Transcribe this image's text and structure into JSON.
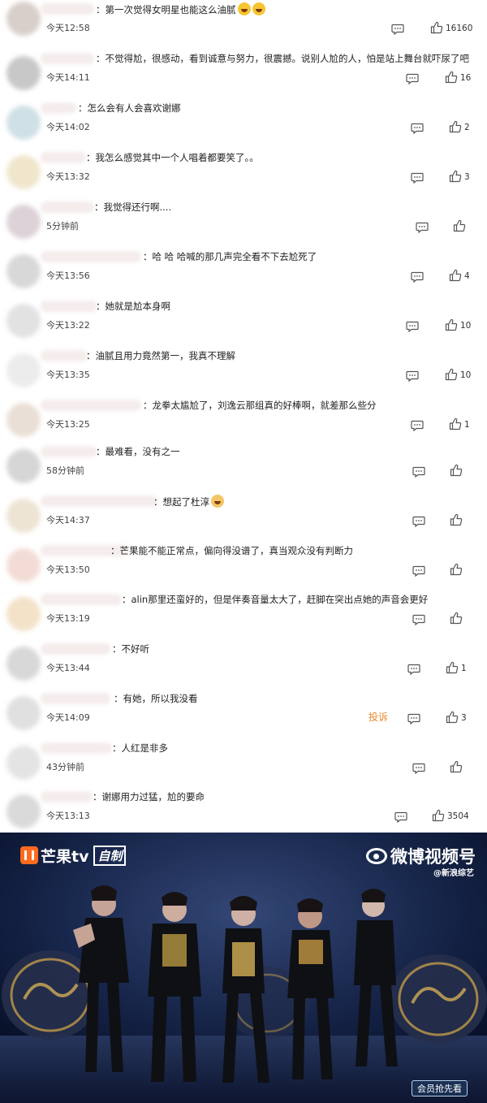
{
  "comments": [
    {
      "text": "：第一次觉得女明星也能这么油腻",
      "emoji": "laugh-emoji",
      "time": "今天12:58",
      "likes": "16160"
    },
    {
      "text": "：不觉得尬，很感动，看到诚意与努力，很震撼。说别人尬的人，怕是站上舞台就吓尿了吧",
      "time": "今天14:11",
      "likes": "16"
    },
    {
      "text": "：怎么会有人会喜欢谢娜",
      "time": "今天14:02",
      "likes": "2"
    },
    {
      "text": "：我怎么感觉其中一个人唱着都要笑了。。",
      "time": "今天13:32",
      "likes": "3"
    },
    {
      "text": "：我觉得还行啊....",
      "time": "5分钟前",
      "likes": ""
    },
    {
      "text": "：哈 哈 哈喊的那几声完全看不下去尬死了",
      "time": "今天13:56",
      "likes": "4"
    },
    {
      "text": "：她就是尬本身啊",
      "time": "今天13:22",
      "likes": "10"
    },
    {
      "text": "：油腻且用力竟然第一，我真不理解",
      "time": "今天13:35",
      "likes": "10"
    },
    {
      "text": "：龙拳太尴尬了，刘逸云那组真的好棒啊，就差那么些分",
      "time": "今天13:25",
      "likes": "1"
    },
    {
      "text": "：最难看，没有之一",
      "time": "58分钟前",
      "likes": ""
    },
    {
      "text": "：想起了杜淳",
      "emoji": "cat-emoji",
      "time": "今天14:37",
      "likes": ""
    },
    {
      "text": "：芒果能不能正常点，偏向得没谱了，真当观众没有判断力",
      "time": "今天13:50",
      "likes": ""
    },
    {
      "text": "：alin那里还蛮好的，但是伴奏音量太大了，赶脚在突出点她的声音会更好",
      "time": "今天13:19",
      "likes": ""
    },
    {
      "text": "：不好听",
      "time": "今天13:44",
      "likes": "1"
    },
    {
      "text": "：有她，所以我没看",
      "time": "今天14:09",
      "likes": "3",
      "report": "投诉"
    },
    {
      "text": "：人红是非多",
      "time": "43分钟前",
      "likes": ""
    },
    {
      "text": "：谢娜用力过猛，尬的要命",
      "time": "今天13:13",
      "likes": "3504"
    }
  ],
  "video": {
    "mango_brand": "芒果tv",
    "mango_tag": "自制",
    "weibo_brand": "微博视频号",
    "weibo_handle": "@新浪综艺",
    "member_badge": "会员抢先看"
  },
  "colors": {
    "accent_report": "#e8892b",
    "stage_bg": "#0d1a36"
  }
}
